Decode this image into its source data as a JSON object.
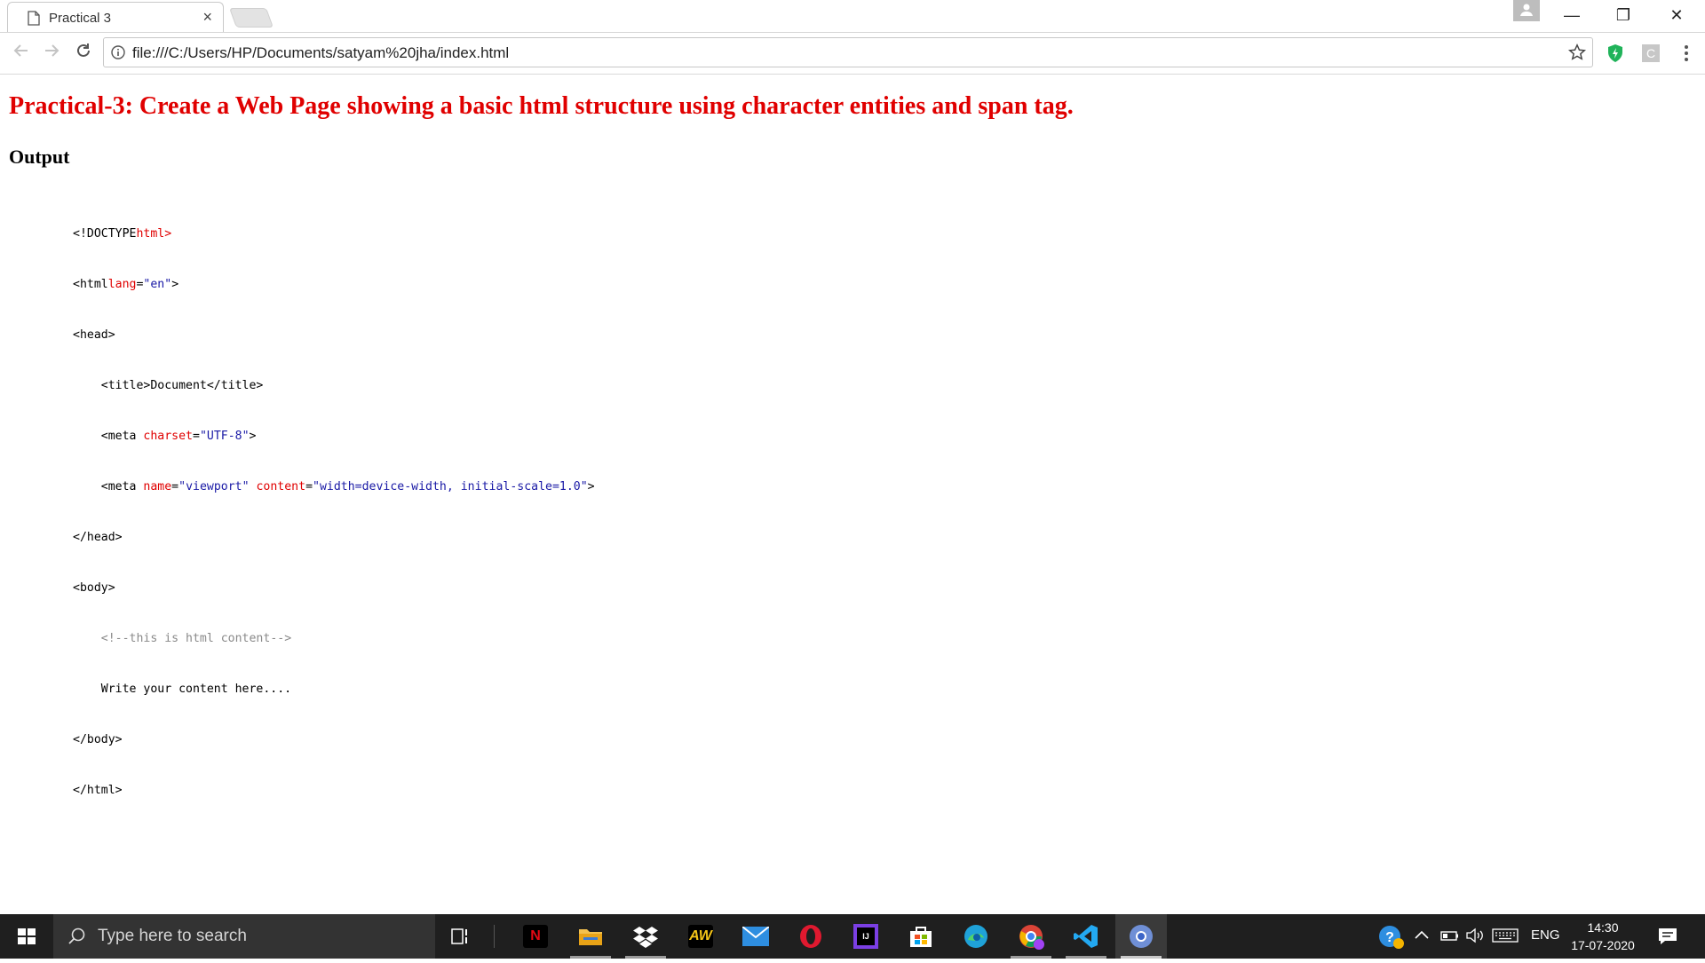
{
  "browser": {
    "tab_title": "Practical 3",
    "tab_close": "×",
    "url": "file:///C:/Users/HP/Documents/satyam%20jha/index.html",
    "window_controls": {
      "minimize": "—",
      "restore": "❐",
      "close": "✕"
    }
  },
  "page": {
    "heading": "Practical-3: Create a Web Page showing a basic html structure using character entities and span tag.",
    "subheading": "Output",
    "code": {
      "l1_tag": "<!DOCTYPE",
      "l1_attr": "html",
      "l1_end": ">",
      "l2_tag": "<html",
      "l2_attr": "lang",
      "l2_eq": "=",
      "l2_val": "\"en\"",
      "l2_end": ">",
      "l3": "<head>",
      "l4": "    <title>Document</title>",
      "l5_tag": "    <meta ",
      "l5_attr": "charset",
      "l5_eq": "=",
      "l5_val": "\"UTF-8\"",
      "l5_end": ">",
      "l6_tag": "    <meta ",
      "l6_attr1": "name",
      "l6_eq1": "=",
      "l6_val1": "\"viewport\"",
      "l6_sp": " ",
      "l6_attr2": "content",
      "l6_eq2": "=",
      "l6_val2": "\"width=device-width, initial-scale=1.0\"",
      "l6_end": ">",
      "l7": "</head>",
      "l8": "<body>",
      "l9_indent": "    ",
      "l9_comment": "<!--this is html content-->",
      "l10": "    Write your content here....",
      "l11": "</body>",
      "l12": "</html>"
    }
  },
  "taskbar": {
    "search_placeholder": "Type here to search",
    "language": "ENG",
    "time": "14:30",
    "date": "17-07-2020"
  },
  "colors": {
    "heading_red": "#e00000",
    "attr_red": "#e00000",
    "value_blue": "#1a1aa6",
    "comment_gray": "#8a8a8a",
    "taskbar_bg": "#1f1f1f"
  },
  "icons": [
    "document-icon",
    "back-icon",
    "forward-icon",
    "reload-icon",
    "info-icon",
    "star-icon",
    "shield-extension-icon",
    "c-extension-icon",
    "menu-dots-icon",
    "windows-start-icon",
    "search-icon",
    "task-view-icon",
    "netflix-icon",
    "file-explorer-icon",
    "dropbox-icon",
    "aw-icon",
    "mail-icon",
    "opera-icon",
    "intellij-icon",
    "store-icon",
    "edge-icon",
    "chrome-profile-icon",
    "vscode-icon",
    "chrome-icon",
    "help-icon",
    "chevron-up-icon",
    "battery-icon",
    "volume-icon",
    "keyboard-icon",
    "notification-icon"
  ]
}
